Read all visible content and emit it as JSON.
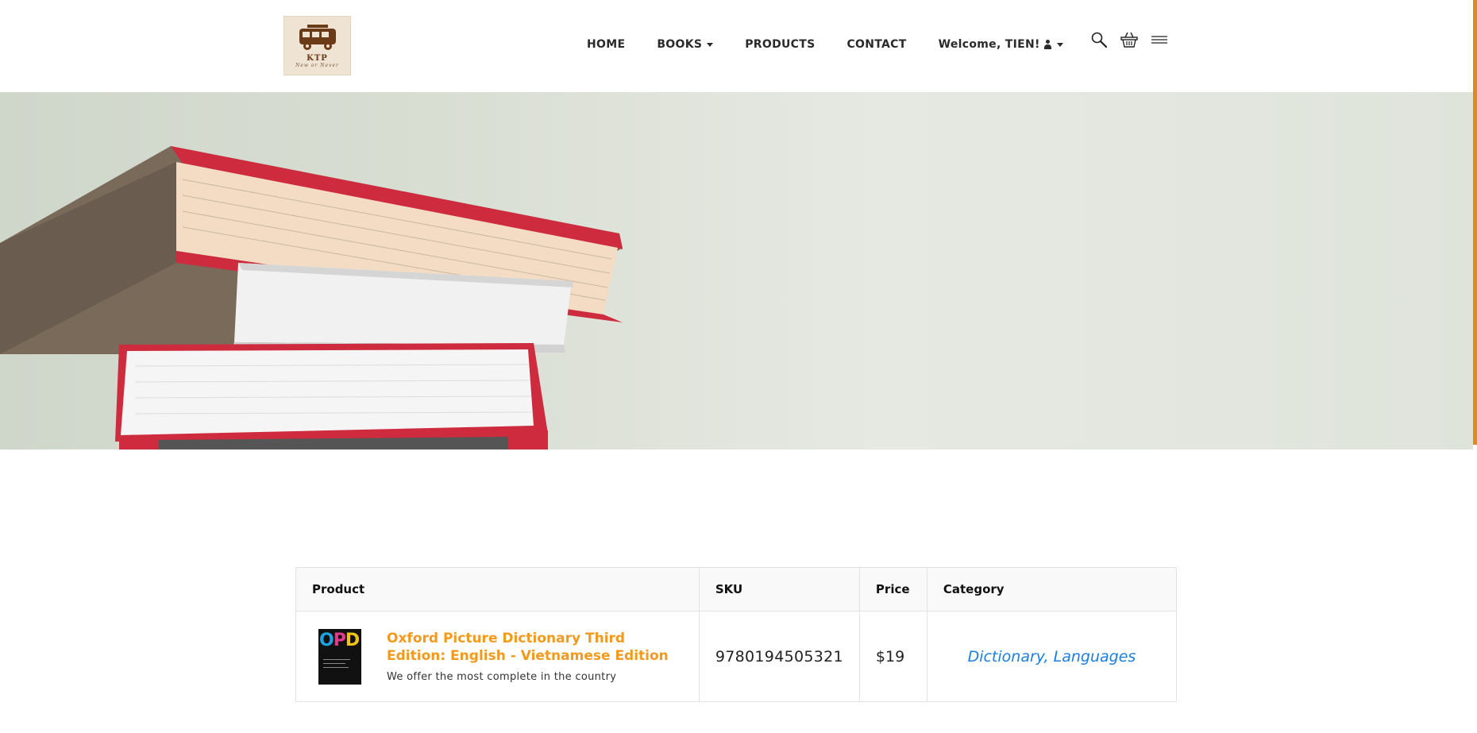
{
  "logo": {
    "title": "KTP",
    "subtitle": "New or Never"
  },
  "nav": {
    "home": "HOME",
    "books": "BOOKS",
    "products": "PRODUCTS",
    "contact": "CONTACT",
    "welcome": "Welcome, TIEN!"
  },
  "icons": {
    "search": "search-icon",
    "cart": "basket-icon",
    "menu": "hamburger-menu-icon",
    "user": "user-icon"
  },
  "table": {
    "headers": {
      "product": "Product",
      "sku": "SKU",
      "price": "Price",
      "category": "Category"
    },
    "rows": [
      {
        "product_name": "Oxford Picture Dictionary Third Edition: English - Vietnamese Edition",
        "description": "We offer the most complete in the country",
        "thumb_text": "OPD",
        "sku": "9780194505321",
        "price": "$19",
        "category": "Dictionary, Languages"
      }
    ]
  },
  "colors": {
    "accent": "#f39a1c",
    "link": "#1a7ee0",
    "scrollbar": "#e08a1e"
  }
}
